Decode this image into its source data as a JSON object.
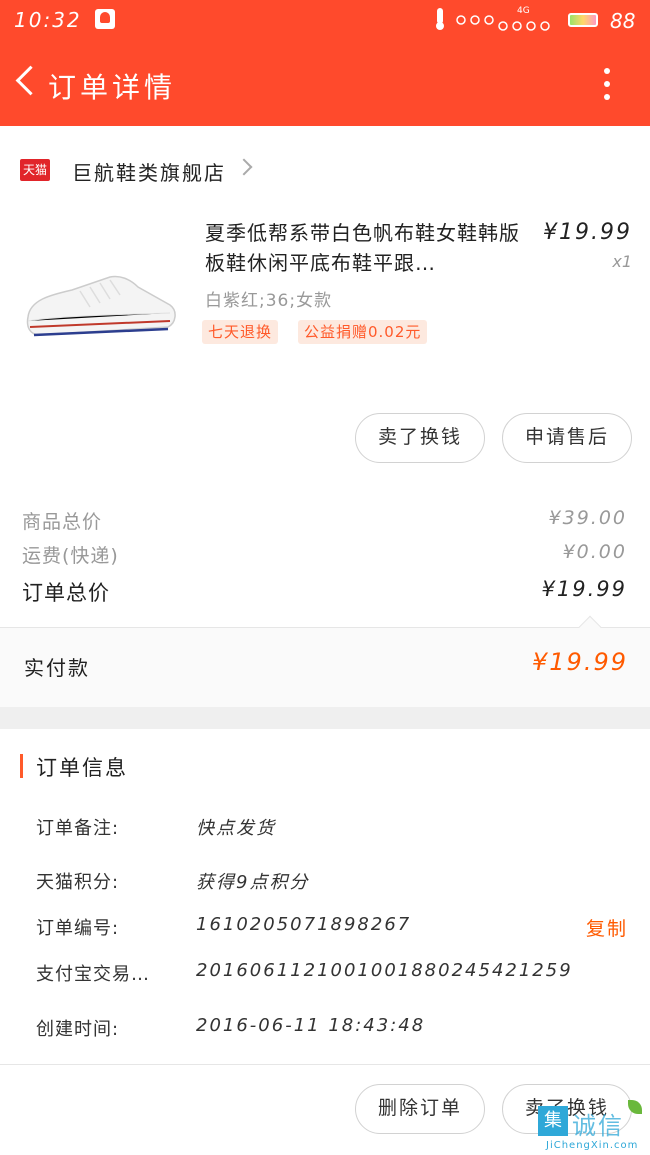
{
  "status_bar": {
    "time": "10:32",
    "battery_level": "88",
    "network": "4G"
  },
  "header": {
    "title": "订单详情"
  },
  "shop": {
    "platform_badge": "天猫",
    "name": "巨航鞋类旗舰店"
  },
  "product": {
    "title": "夏季低帮系带白色帆布鞋女鞋韩版板鞋休闲平底布鞋平跟…",
    "price": "¥19.99",
    "quantity": "x1",
    "sku": "白紫红;36;女款",
    "tags": [
      "七天退换",
      "公益捐赠0.02元"
    ]
  },
  "item_actions": {
    "resell": "卖了换钱",
    "after_sale": "申请售后"
  },
  "prices": [
    {
      "label": "商品总价",
      "value": "¥39.00"
    },
    {
      "label": "运费(快递)",
      "value": "¥0.00"
    },
    {
      "label": "订单总价",
      "value": "¥19.99"
    }
  ],
  "paid": {
    "label": "实付款",
    "value": "¥19.99"
  },
  "order_info": {
    "title": "订单信息",
    "rows": [
      {
        "label": "订单备注:",
        "value": "快点发货"
      },
      {
        "label": "天猫积分:",
        "value": "获得9点积分"
      },
      {
        "label": "订单编号:",
        "value": "1610205071898267"
      },
      {
        "label": "支付宝交易…",
        "value": "2016061121001001880245421259"
      },
      {
        "label": "创建时间:",
        "value": "2016-06-11  18:43:48"
      }
    ],
    "copy": "复制"
  },
  "bottom_actions": {
    "delete": "删除订单",
    "resell": "卖了换钱"
  },
  "watermark": {
    "mark": "集",
    "text": "诚信",
    "domain": "JiChengXin.com"
  },
  "colors": {
    "accent": "#ff4a2c",
    "price_orange": "#ff5a00",
    "tag_bg": "#fde9df"
  }
}
